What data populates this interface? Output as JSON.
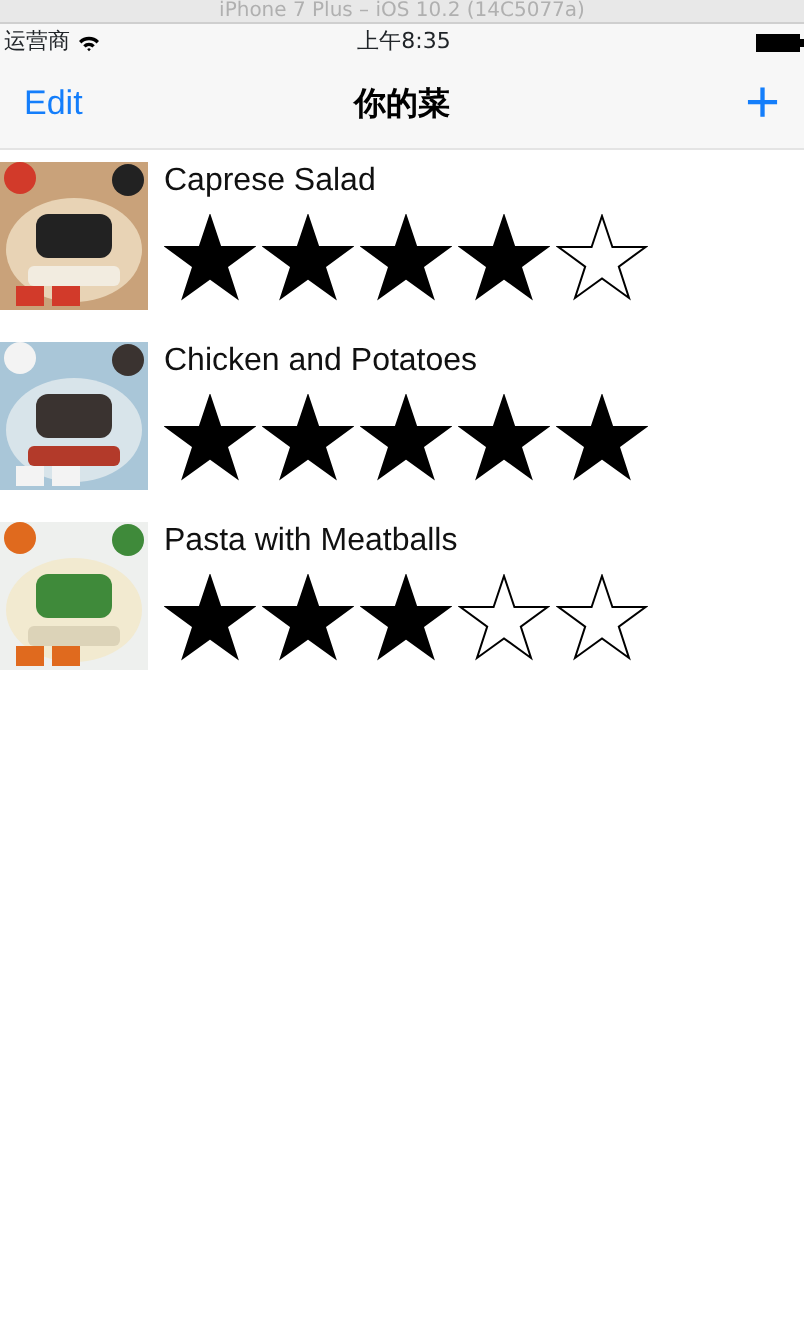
{
  "window": {
    "title": "iPhone 7 Plus – iOS 10.2 (14C5077a)"
  },
  "status_bar": {
    "carrier": "运营商",
    "time": "上午8:35"
  },
  "nav_bar": {
    "left_button": "Edit",
    "title": "你的菜",
    "right_button": "+"
  },
  "meals": [
    {
      "name": "Caprese Salad",
      "stars": 4
    },
    {
      "name": "Chicken and Potatoes",
      "stars": 5
    },
    {
      "name": "Pasta with Meatballs",
      "stars": 3
    }
  ]
}
